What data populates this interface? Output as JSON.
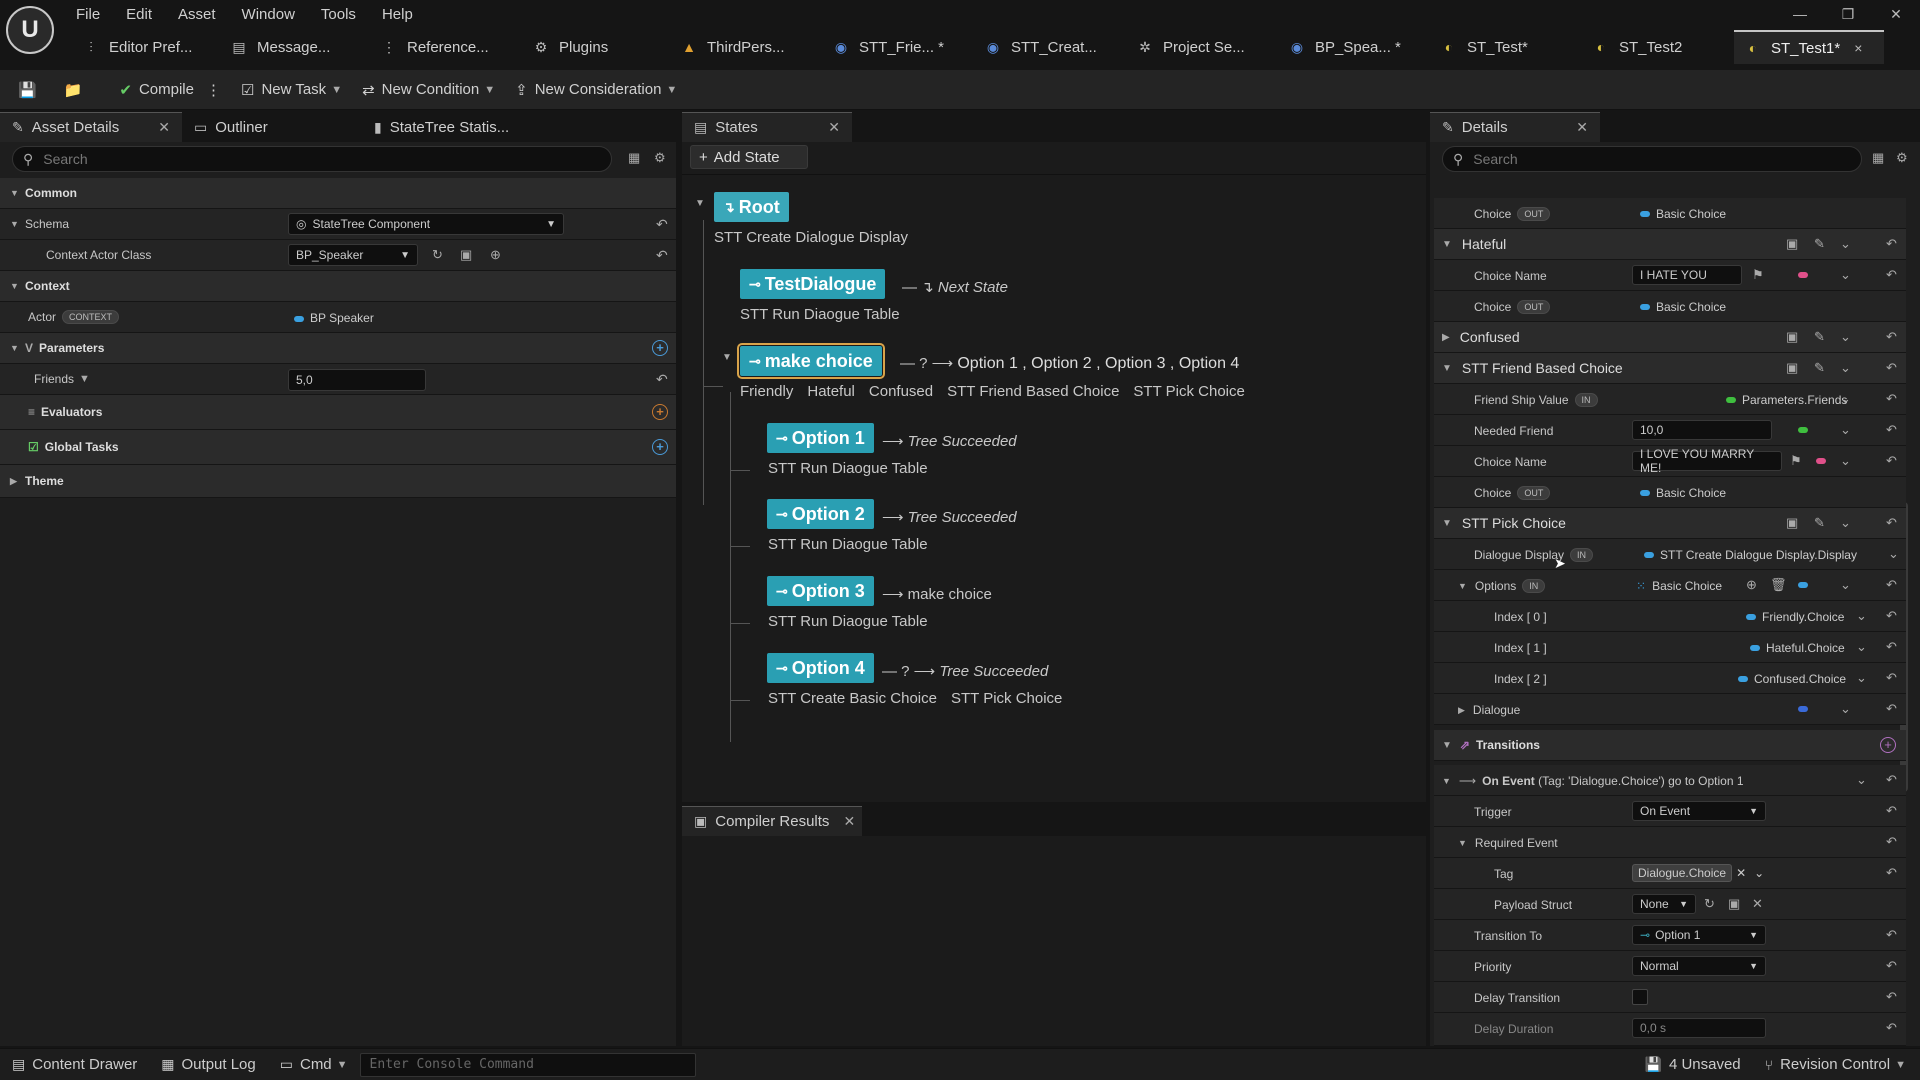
{
  "menu": [
    "File",
    "Edit",
    "Asset",
    "Window",
    "Tools",
    "Help"
  ],
  "doc_tabs": [
    {
      "label": "Editor Pref...",
      "icon": "sliders-icon"
    },
    {
      "label": "Message...",
      "icon": "message-log-icon"
    },
    {
      "label": "Reference...",
      "icon": "reference-viewer-icon"
    },
    {
      "label": "Plugins",
      "icon": "plugin-icon"
    },
    {
      "label": "ThirdPers...",
      "icon": "level-icon"
    },
    {
      "label": "STT_Frie... *",
      "icon": "blueprint-icon"
    },
    {
      "label": "STT_Creat...",
      "icon": "blueprint-icon"
    },
    {
      "label": "Project Se...",
      "icon": "gear-icon"
    },
    {
      "label": "BP_Spea... *",
      "icon": "blueprint-icon"
    },
    {
      "label": "ST_Test*",
      "icon": "statetree-icon"
    },
    {
      "label": "ST_Test2",
      "icon": "statetree-icon"
    },
    {
      "label": "ST_Test1*",
      "icon": "statetree-icon",
      "close": "×"
    }
  ],
  "toolbar": {
    "compile": "Compile",
    "new_task": "New Task",
    "new_condition": "New Condition",
    "new_consideration": "New Consideration"
  },
  "left_panel": {
    "tabs": [
      "Asset Details",
      "Outliner",
      "StateTree Statis..."
    ],
    "search_placeholder": "Search",
    "common": "Common",
    "schema_label": "Schema",
    "schema_value": "StateTree Component",
    "context_actor_class_label": "Context Actor Class",
    "context_actor_class_value": "BP_Speaker",
    "context": "Context",
    "actor_label": "Actor",
    "actor_badge": "CONTEXT",
    "actor_value": "BP Speaker",
    "parameters": "Parameters",
    "friends_label": "Friends",
    "friends_value": "5,0",
    "evaluators": "Evaluators",
    "global_tasks": "Global Tasks",
    "theme": "Theme"
  },
  "states_panel": {
    "tab": "States",
    "add_state": "Add State",
    "root": {
      "name": "Root",
      "tasks": "STT Create Dialogue Display"
    },
    "test_dialogue": {
      "name": "TestDialogue",
      "tasks": "STT Run Diaogue Table",
      "transition": "Next State"
    },
    "make_choice": {
      "name": "make choice",
      "transition_prefix": "?",
      "transitions": "Option 1 ,  Option 2 ,  Option 3 ,  Option 4",
      "tasks": [
        "Friendly",
        "Hateful",
        "Confused",
        "STT Friend Based Choice",
        "STT Pick Choice"
      ]
    },
    "option1": {
      "name": "Option 1",
      "transition": "Tree Succeeded",
      "tasks": "STT Run Diaogue Table"
    },
    "option2": {
      "name": "Option 2",
      "transition": "Tree Succeeded",
      "tasks": "STT Run Diaogue Table"
    },
    "option3": {
      "name": "Option 3",
      "transition": "make choice",
      "tasks": "STT Run Diaogue Table"
    },
    "option4": {
      "name": "Option 4",
      "transition_prefix": "?",
      "transition": "Tree Succeeded",
      "tasks": [
        "STT Create Basic Choice",
        "STT Pick Choice"
      ]
    }
  },
  "compiler_results": {
    "tab": "Compiler Results"
  },
  "details": {
    "tab": "Details",
    "search_placeholder": "Search",
    "rows": {
      "choice1_label": "Choice",
      "choice1_badge": "OUT",
      "choice1_value": "Basic Choice",
      "hateful": "Hateful",
      "hateful_choice_name_label": "Choice Name",
      "hateful_choice_name_value": "I HATE YOU",
      "hateful_choice_label": "Choice",
      "hateful_choice_badge": "OUT",
      "hateful_choice_value": "Basic Choice",
      "confused": "Confused",
      "stt_friend": "STT Friend Based Choice",
      "friend_ship_label": "Friend Ship Value",
      "friend_ship_badge": "IN",
      "friend_ship_value": "Parameters.Friends",
      "needed_friend_label": "Needed Friend",
      "needed_friend_value": "10,0",
      "friend_choice_name_label": "Choice Name",
      "friend_choice_name_value": "I LOVE YOU MARRY ME!",
      "friend_choice_label": "Choice",
      "friend_choice_badge": "OUT",
      "friend_choice_value": "Basic Choice",
      "stt_pick": "STT Pick Choice",
      "dialogue_display_label": "Dialogue Display",
      "dialogue_display_badge": "IN",
      "dialogue_display_value": "STT Create Dialogue Display.Display",
      "options_label": "Options",
      "options_badge": "IN",
      "options_value": "Basic Choice",
      "index0_label": "Index [ 0 ]",
      "index0_value": "Friendly.Choice",
      "index1_label": "Index [ 1 ]",
      "index1_value": "Hateful.Choice",
      "index2_label": "Index [ 2 ]",
      "index2_value": "Confused.Choice",
      "dialogue_label": "Dialogue",
      "transitions": "Transitions",
      "on_event_bold": "On Event",
      "on_event_rest": "(Tag: 'Dialogue.Choice') go to Option 1",
      "trigger_label": "Trigger",
      "trigger_value": "On Event",
      "required_event_label": "Required Event",
      "tag_label": "Tag",
      "tag_value": "Dialogue.Choice",
      "payload_label": "Payload Struct",
      "payload_value": "None",
      "transition_to_label": "Transition To",
      "transition_to_value": "Option 1",
      "priority_label": "Priority",
      "priority_value": "Normal",
      "delay_transition_label": "Delay Transition",
      "delay_duration_label": "Delay Duration",
      "delay_duration_value": "0,0 s"
    }
  },
  "statusbar": {
    "content_drawer": "Content Drawer",
    "output_log": "Output Log",
    "cmd": "Cmd",
    "console_placeholder": "Enter Console Command",
    "unsaved": "4 Unsaved",
    "revision_control": "Revision Control"
  },
  "colors": {
    "state_teal": "#2a9fb3",
    "selection_gold": "#d8a34a",
    "pin_green": "#3fbf3f",
    "pin_pink": "#e0508a",
    "pin_blue": "#3aa0e0"
  }
}
